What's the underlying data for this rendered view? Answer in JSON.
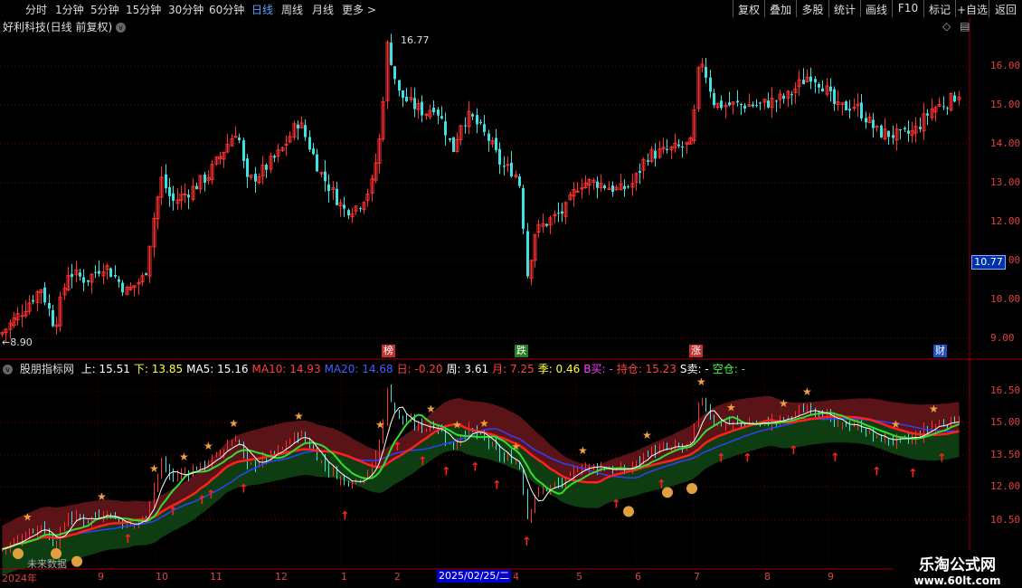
{
  "toolbar": {
    "timeframes": [
      "分时",
      "1分钟",
      "5分钟",
      "15分钟",
      "30分钟",
      "60分钟",
      "日线",
      "周线",
      "月线",
      "更多 >"
    ],
    "active_timeframe": "日线",
    "right_buttons": [
      "复权",
      "叠加",
      "多股",
      "统计",
      "画线",
      "F10",
      "标记",
      "+自选",
      "返回"
    ]
  },
  "main_panel": {
    "title": "好利科技(日线 前复权)",
    "high_marker": "16.77",
    "low_marker": "8.90",
    "current_price": "10.77",
    "y_ticks": [
      "16.00",
      "15.00",
      "14.00",
      "13.00",
      "12.00",
      "11.00",
      "10.00",
      "9.00"
    ],
    "event_tags": [
      {
        "label": "榜",
        "color": "#c03030"
      },
      {
        "label": "跌",
        "color": "#208020"
      },
      {
        "label": "涨",
        "color": "#c03030"
      },
      {
        "label": "财",
        "color": "#2050c0"
      }
    ]
  },
  "indicator_panel": {
    "name": "股朋指标网",
    "values": [
      {
        "label": "上: 15.51",
        "color": "#ffffff"
      },
      {
        "label": "下: 13.85",
        "color": "#ffff40"
      },
      {
        "label": "MA5: 15.16",
        "color": "#ffffff"
      },
      {
        "label": "MA10: 14.93",
        "color": "#ff4040"
      },
      {
        "label": "MA20: 14.68",
        "color": "#4060ff"
      },
      {
        "label": "日: -0.20",
        "color": "#ff4040"
      },
      {
        "label": "周: 3.61",
        "color": "#ffffff"
      },
      {
        "label": "月: 7.25",
        "color": "#ff4040"
      },
      {
        "label": "季: 0.46",
        "color": "#ffff40"
      },
      {
        "label": "B买: -",
        "color": "#ff40ff"
      },
      {
        "label": "持仓: 15.23",
        "color": "#ff4040"
      },
      {
        "label": "S卖: -",
        "color": "#ffffff"
      },
      {
        "label": "空仓: -",
        "color": "#40ff40"
      }
    ],
    "y_ticks": [
      "16.50",
      "15.00",
      "13.50",
      "12.00",
      "10.50"
    ],
    "overlay_text": "未来数据"
  },
  "x_axis": {
    "labels": [
      "2024年",
      "9",
      "10",
      "11",
      "12",
      "1",
      "2",
      "3",
      "4",
      "5",
      "6",
      "7",
      "8",
      "9"
    ],
    "cursor_date": "2025/02/25/二"
  },
  "watermark": {
    "line1": "乐淘公式网",
    "line2": "www.60lt.com"
  },
  "colors": {
    "up": "#ff3030",
    "down": "#40e0e0",
    "grid": "#800000",
    "band_upper": "#5a1418",
    "band_lower": "#0f3d12"
  }
}
